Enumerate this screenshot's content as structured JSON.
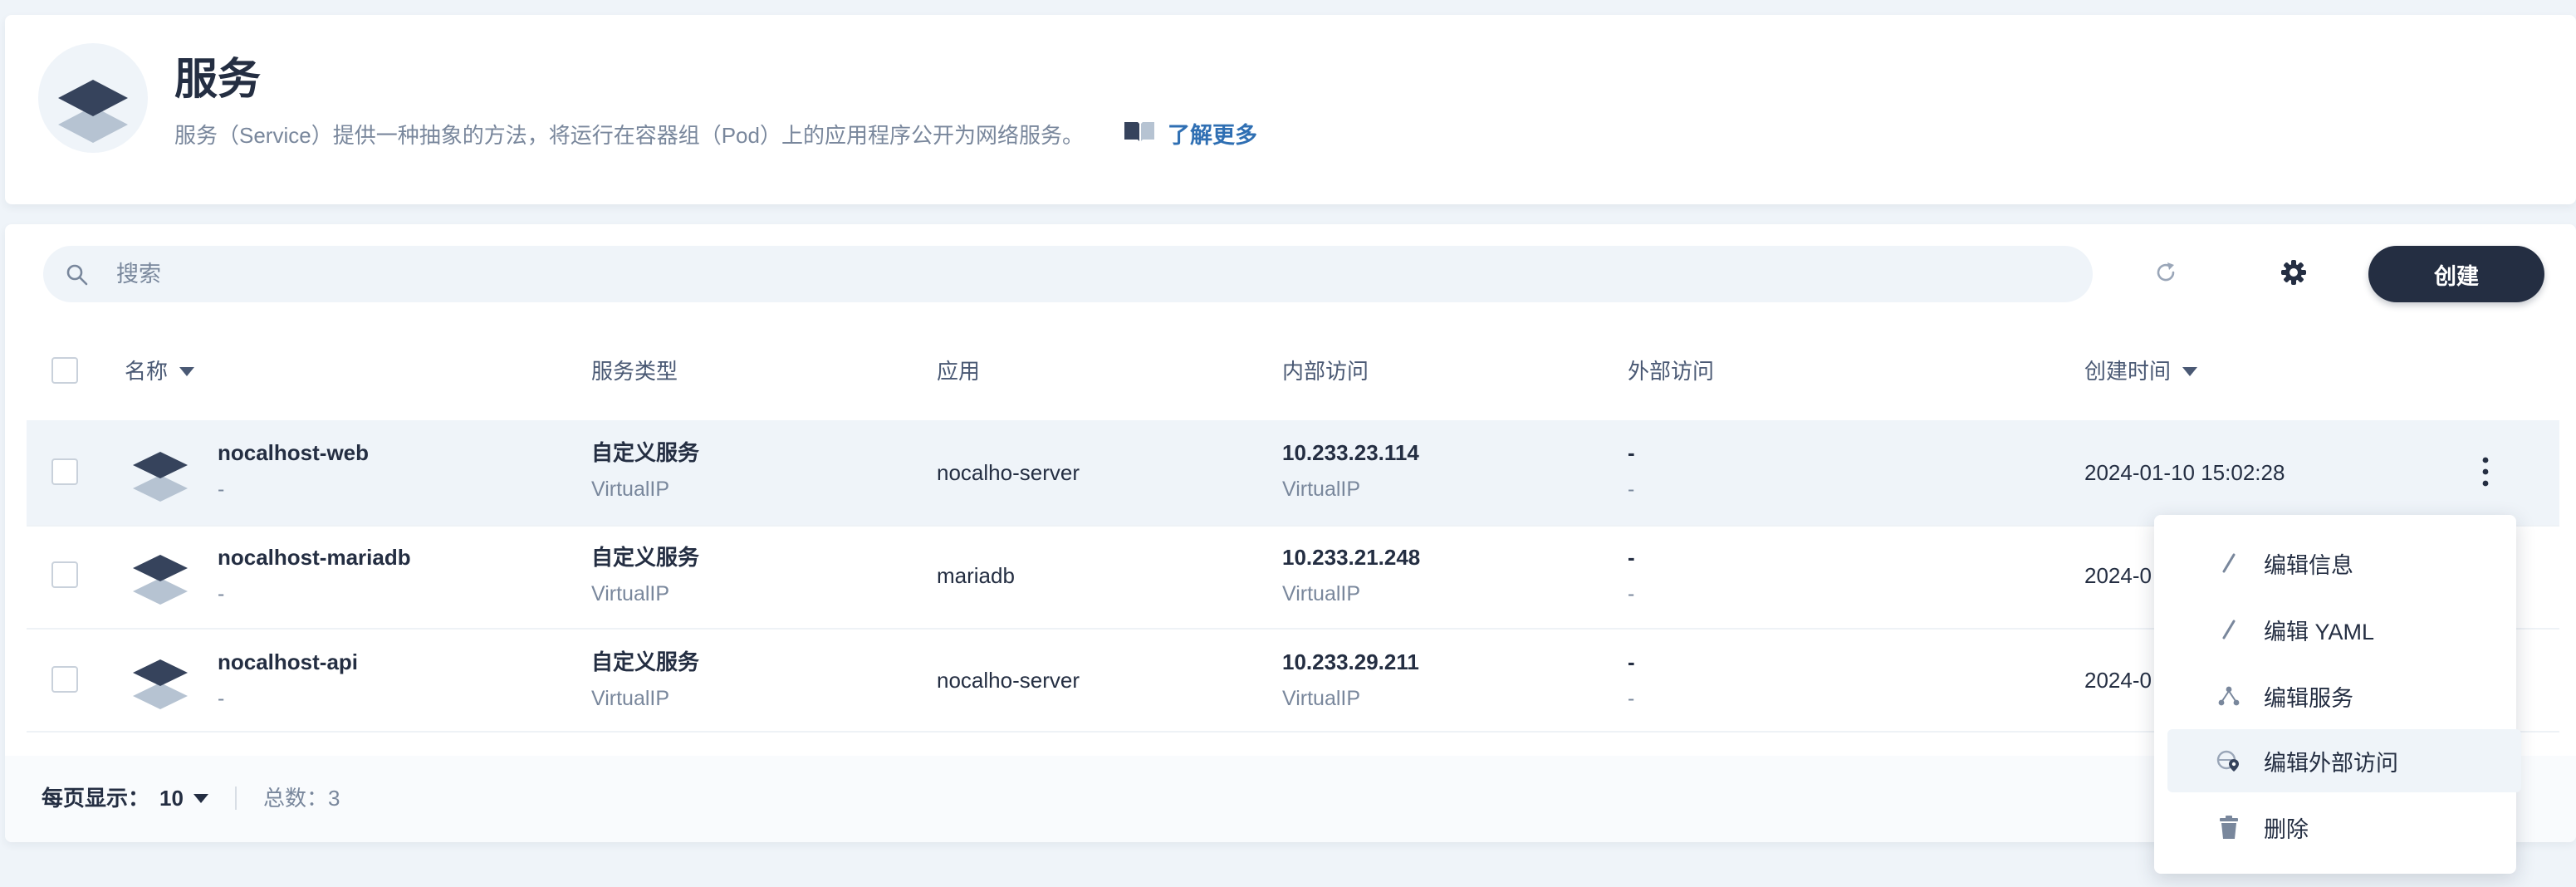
{
  "header": {
    "title": "服务",
    "description": "服务（Service）提供一种抽象的方法，将运行在容器组（Pod）上的应用程序公开为网络服务。",
    "learn_more": "了解更多"
  },
  "toolbar": {
    "search_placeholder": "搜索",
    "create_label": "创建"
  },
  "table": {
    "columns": {
      "name": "名称",
      "type": "服务类型",
      "app": "应用",
      "internal": "内部访问",
      "external": "外部访问",
      "created": "创建时间"
    },
    "rows": [
      {
        "name": "nocalhost-web",
        "name_sub": "-",
        "type": "自定义服务",
        "type_sub": "VirtualIP",
        "app": "nocalho-server",
        "internal": "10.233.23.114",
        "internal_sub": "VirtualIP",
        "external": "-",
        "external_sub": "-",
        "created": "2024-01-10 15:02:28"
      },
      {
        "name": "nocalhost-mariadb",
        "name_sub": "-",
        "type": "自定义服务",
        "type_sub": "VirtualIP",
        "app": "mariadb",
        "internal": "10.233.21.248",
        "internal_sub": "VirtualIP",
        "external": "-",
        "external_sub": "-",
        "created": "2024-0"
      },
      {
        "name": "nocalhost-api",
        "name_sub": "-",
        "type": "自定义服务",
        "type_sub": "VirtualIP",
        "app": "nocalho-server",
        "internal": "10.233.29.211",
        "internal_sub": "VirtualIP",
        "external": "-",
        "external_sub": "-",
        "created": "2024-0"
      }
    ]
  },
  "footer": {
    "per_page_label": "每页显示：",
    "per_page_value": "10",
    "total": "总数：3"
  },
  "menu": {
    "items": [
      {
        "label": "编辑信息",
        "icon": "pen-icon"
      },
      {
        "label": "编辑 YAML",
        "icon": "pen-icon"
      },
      {
        "label": "编辑服务",
        "icon": "topology-icon"
      },
      {
        "label": "编辑外部访问",
        "icon": "globe-pin-icon"
      },
      {
        "label": "删除",
        "icon": "trash-icon"
      }
    ],
    "active_index": 3
  },
  "colors": {
    "background": "#eff4f9",
    "primary_dark": "#242e42",
    "muted_text": "#79879c",
    "link": "#2f6fb3"
  }
}
